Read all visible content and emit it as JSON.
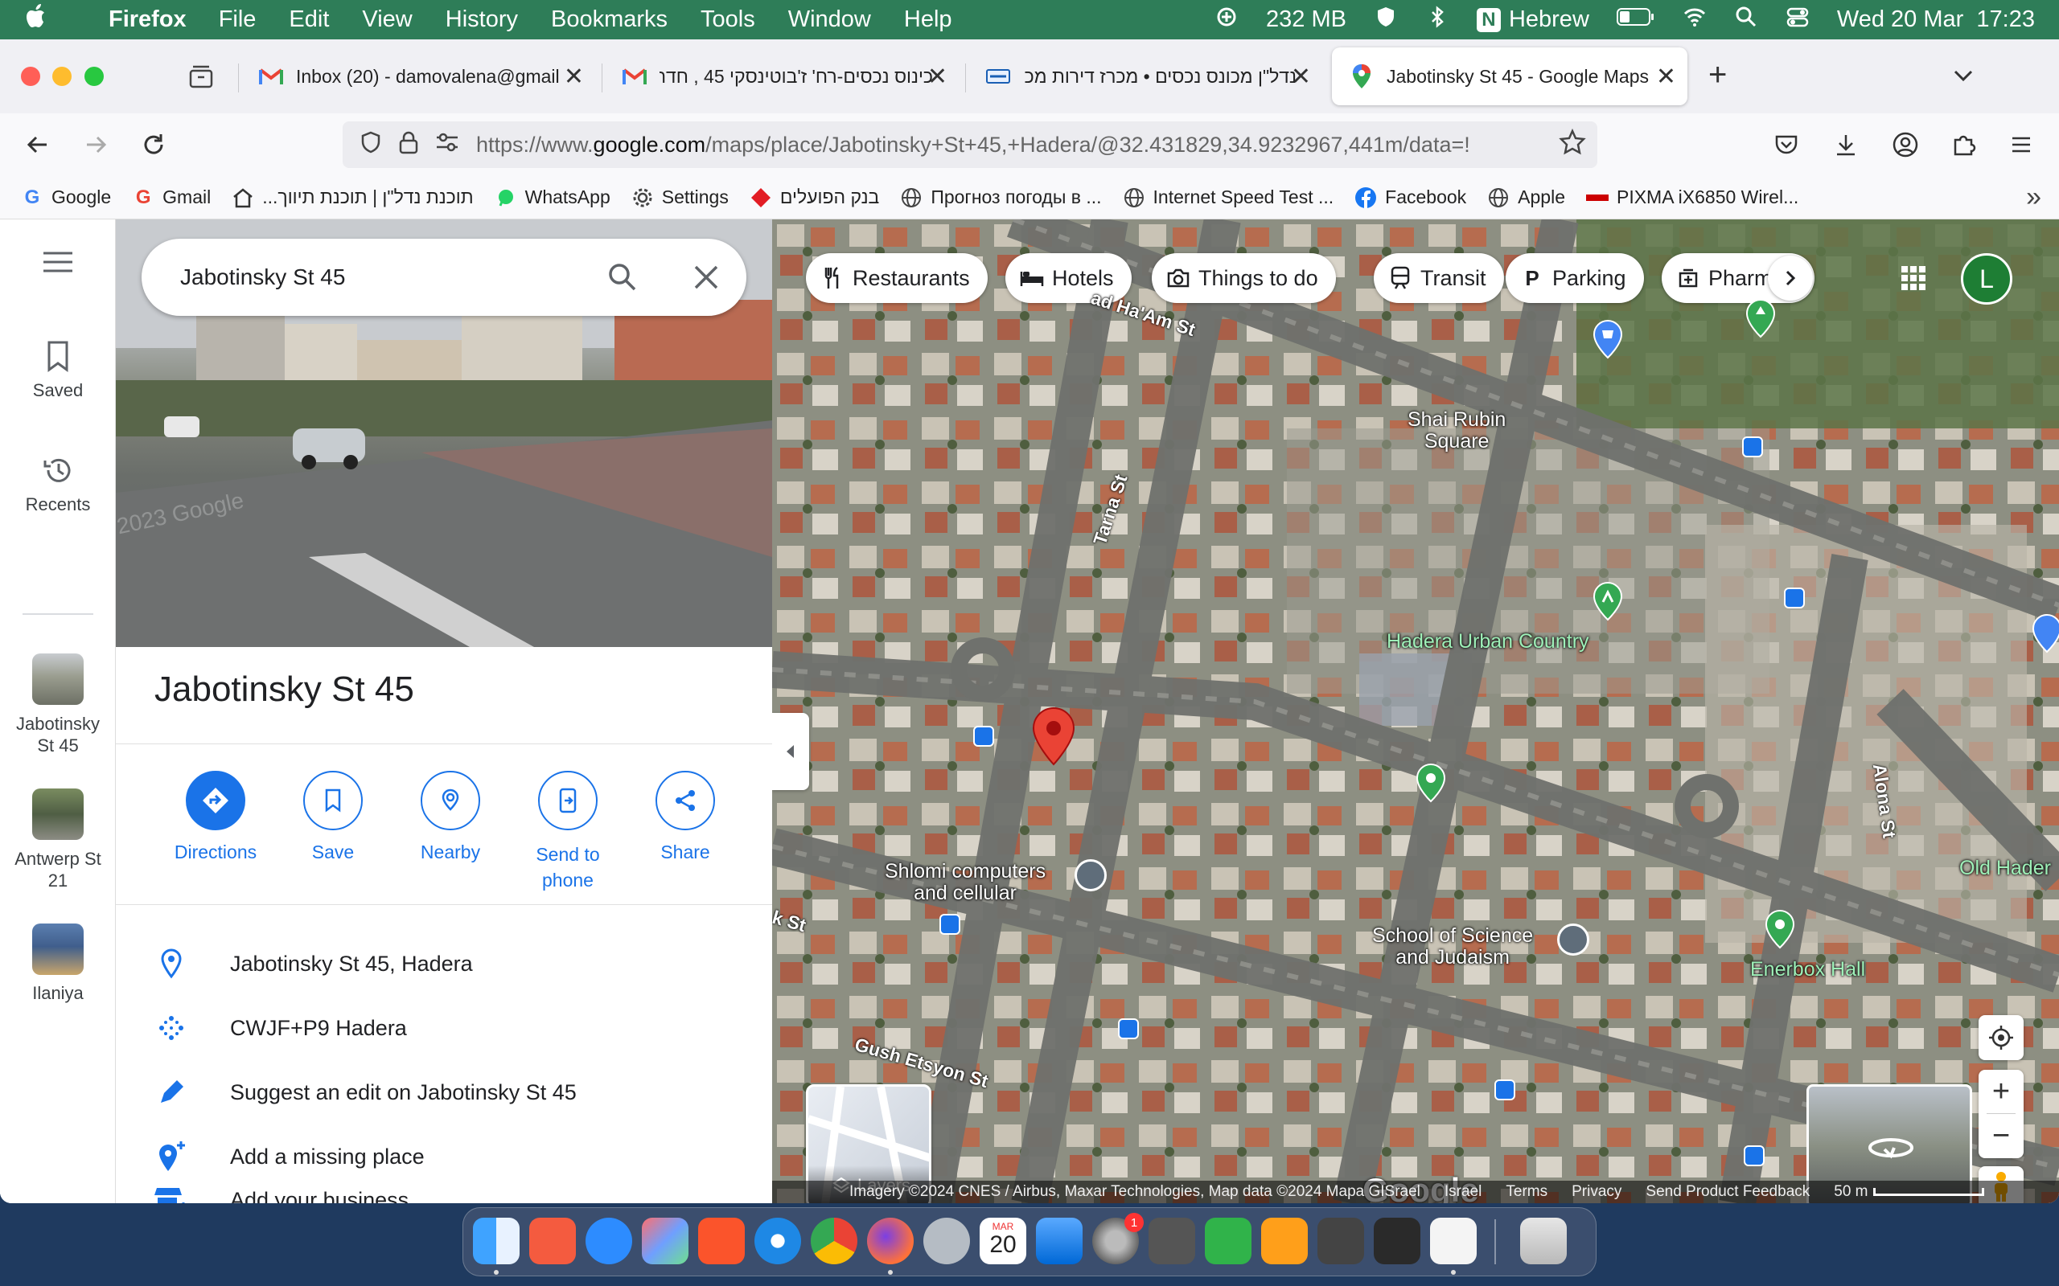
{
  "menubar": {
    "app_name": "Firefox",
    "menus": [
      "File",
      "Edit",
      "View",
      "History",
      "Bookmarks",
      "Tools",
      "Window",
      "Help"
    ],
    "memory": "232 MB",
    "input_source": "Hebrew",
    "datetime": "Wed 20 Mar  17:23"
  },
  "tabs": [
    {
      "title": "Inbox (20) - damovalena@gmail",
      "icon": "gmail-icon"
    },
    {
      "title": "כינוס נכסים-רח' ז'בוטינסקי 45 , חדר",
      "icon": "gmail-icon"
    },
    {
      "title": "נדל\"ן מכונס נכסים • מכרז דירות מכונ",
      "icon": "site-icon"
    },
    {
      "title": "Jabotinsky St 45 - Google Maps",
      "icon": "google-maps-icon"
    }
  ],
  "url": {
    "prefix": "https://www.",
    "domain": "google.com",
    "path": "/maps/place/Jabotinsky+St+45,+Hadera/@32.431829,34.9232967,441m/data=!"
  },
  "bookmarks": [
    "Google",
    "Gmail",
    "תוכנת נדל\"ן | תוכנת תיווך...",
    "WhatsApp",
    "Settings",
    "בנק הפועלים",
    "Прогноз погоды в ...",
    "Internet Speed Test ...",
    "Facebook",
    "Apple",
    "PIXMA iX6850 Wirel..."
  ],
  "rail": {
    "saved": "Saved",
    "recents": "Recents",
    "recent_places": [
      "Jabotinsky St 45",
      "Antwerp St 21",
      "Ilaniya"
    ]
  },
  "panel": {
    "search_value": "Jabotinsky St 45",
    "place_title": "Jabotinsky St 45",
    "actions": [
      "Directions",
      "Save",
      "Nearby",
      "Send to phone",
      "Share"
    ],
    "info": [
      "Jabotinsky St 45, Hadera",
      "CWJF+P9 Hadera",
      "Suggest an edit on Jabotinsky St 45",
      "Add a missing place",
      "Add your business"
    ],
    "streetview_watermark": "2023 Google"
  },
  "map": {
    "chips": [
      "Restaurants",
      "Hotels",
      "Things to do",
      "Transit",
      "Parking",
      "Pharma"
    ],
    "avatar_letter": "L",
    "places": {
      "shai_rubin": "Shai Rubin\nSquare",
      "hadera_urban": "Hadera Urban Country",
      "shlomi": "Shlomi computers\nand cellular",
      "school": "School of Science\nand Judaism",
      "enerbox": "Enerbox Hall",
      "old_hadera": "Old Hader"
    },
    "streets": {
      "tarna": "Tarna St",
      "ham": "ad Ha'Am St",
      "alona": "Alona St",
      "gush": "Gush Etsyon St",
      "k_st": "k St"
    },
    "layers_label": "Layers",
    "google_logo": "Google",
    "attribution": [
      "Imagery ©2024 CNES / Airbus, Maxar Technologies, Map data ©2024 Mapa GISrael",
      "Israel",
      "Terms",
      "Privacy",
      "Send Product Feedback",
      "50 m"
    ]
  },
  "dock": {
    "calendar_month": "MAR",
    "calendar_day": "20",
    "settings_badge": "1"
  },
  "colors": {
    "menubar": "#2e7d58",
    "accent": "#1a73e8",
    "pin_red": "#ea4335",
    "poi_green": "#34a853"
  }
}
